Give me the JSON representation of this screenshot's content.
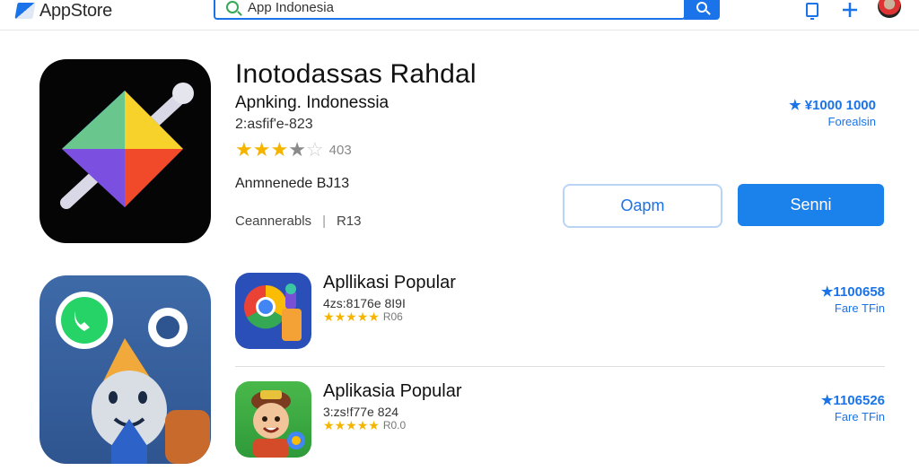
{
  "header": {
    "logo_text": "AppStore",
    "search": {
      "value": "App Indonesia",
      "placeholder": ""
    },
    "icons": [
      "document-icon",
      "plus-icon",
      "avatar"
    ]
  },
  "featured": {
    "title": "Inotodassas Rahdal",
    "subtitle": "Apnking. Indonessia",
    "meta": "2:asfif'e-823",
    "rating": {
      "value": 3.5,
      "max": 5,
      "count": "403"
    },
    "note": "Anmnenede BJ13",
    "category": "Ceannerabls",
    "category_sep": "|",
    "category_value": "R13",
    "price": "★ ¥1000 1000",
    "price_sub": "Forealsin",
    "open_button": "Oapm",
    "send_button": "Senni",
    "icon": "kite-pencil-icon"
  },
  "secondary_icon": "chat-mascot-icon",
  "list": [
    {
      "title": "Apllikasi Popular",
      "meta": "4zs:8176e 8I9I",
      "rating": {
        "value": 5,
        "max": 5,
        "count": "R06"
      },
      "price": "★1100658",
      "price_sub": "Fare TFin",
      "icon": "browser-puzzle-icon"
    },
    {
      "title": "Aplikasia Popular",
      "meta": "3:zs!f77e 824",
      "rating": {
        "value": 5,
        "max": 5,
        "count": "R0.0"
      },
      "price": "★1106526",
      "price_sub": "Fare TFin",
      "icon": "character-game-icon"
    }
  ],
  "colors": {
    "accent": "#1a73e8",
    "star": "#f4b400"
  }
}
